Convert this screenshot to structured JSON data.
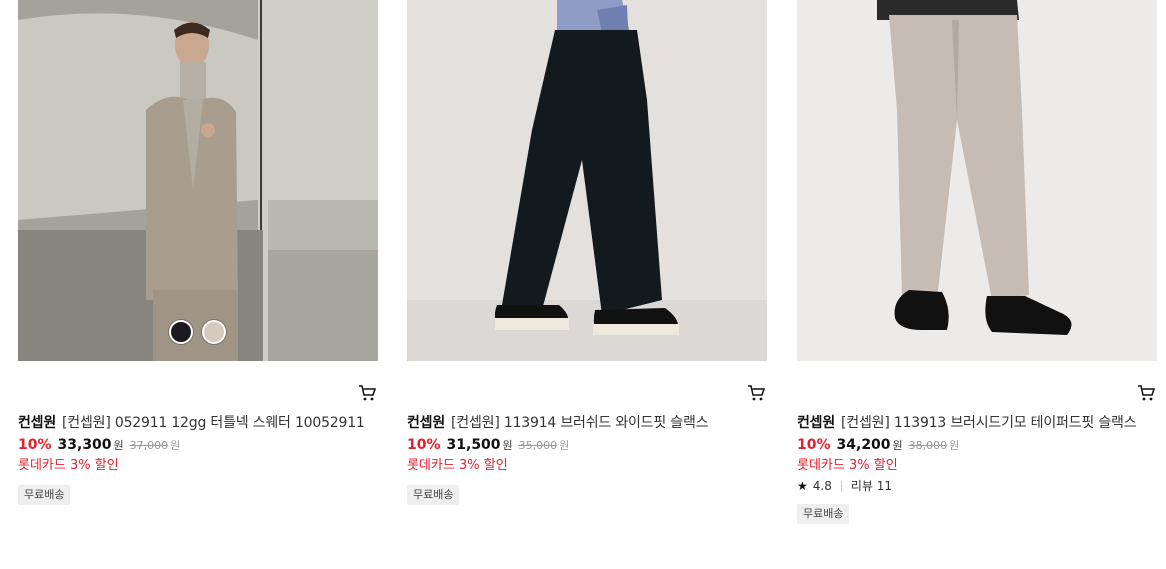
{
  "products": [
    {
      "brand": "컨셉원",
      "name": "[컨셉원] 052911 12gg 터틀넥 스웨터 10052911",
      "discount_rate": "10%",
      "price": "33,300",
      "price_unit": "원",
      "original_price": "37,000",
      "original_unit": "원",
      "card_discount": "롯데카드 3% 할인",
      "badge": "무료배송",
      "color_options": [
        "#1a1a20",
        "#d6c9bd"
      ]
    },
    {
      "brand": "컨셉원",
      "name": "[컨셉원] 113914 브러쉬드 와이드핏 슬랙스",
      "discount_rate": "10%",
      "price": "31,500",
      "price_unit": "원",
      "original_price": "35,000",
      "original_unit": "원",
      "card_discount": "롯데카드 3% 할인",
      "badge": "무료배송"
    },
    {
      "brand": "컨셉원",
      "name": "[컨셉원] 113913 브러시드기모 테이퍼드핏 슬랙스",
      "discount_rate": "10%",
      "price": "34,200",
      "price_unit": "원",
      "original_price": "38,000",
      "original_unit": "원",
      "card_discount": "롯데카드 3% 할인",
      "rating": "4.8",
      "review_label": "리뷰 11",
      "badge": "무료배송"
    }
  ],
  "icons": {
    "cart": "cart-icon",
    "star": "star-icon"
  },
  "colors": {
    "accent_red": "#e3202e",
    "badge_bg": "#eeeeee"
  }
}
